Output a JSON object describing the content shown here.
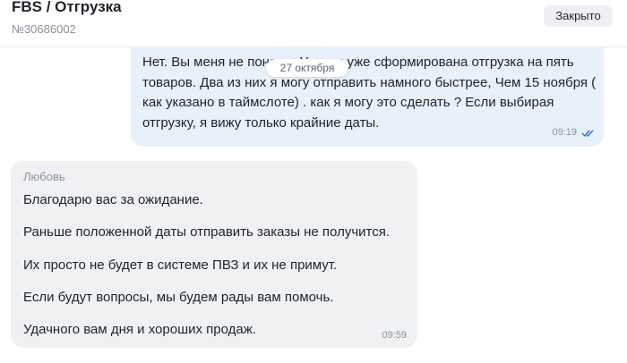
{
  "header": {
    "title": "FBS / Отгрузка",
    "order_number": "№30686002",
    "close_label": "Закрыто"
  },
  "chat": {
    "date_divider": "27 октября",
    "outgoing": {
      "text": "Нет. Вы меня не поняли. У меня уже сформирована отгрузка на пять товаров. Два из них я могу отправить намного быстрее, Чем 15 ноября ( как указано в таймслоте) . как я могу это сделать ? Если выбирая отгрузку, я вижу только крайние даты.",
      "time": "09:19",
      "status_icon": "double-check-icon"
    },
    "incoming": {
      "sender": "Любовь",
      "lines": [
        "Благодарю вас за ожидание.",
        "Раньше положенной даты отправить заказы не получится.",
        "Их просто не будет в системе ПВЗ и их не примут.",
        "Если будут вопросы, мы будем рады вам помочь.",
        "Удачного вам дня и хороших продаж."
      ],
      "time": "09:59"
    }
  },
  "colors": {
    "outgoing_bubble": "#e8f0fb",
    "incoming_bubble": "#f0f1f3",
    "check_color": "#2f6fd6"
  }
}
